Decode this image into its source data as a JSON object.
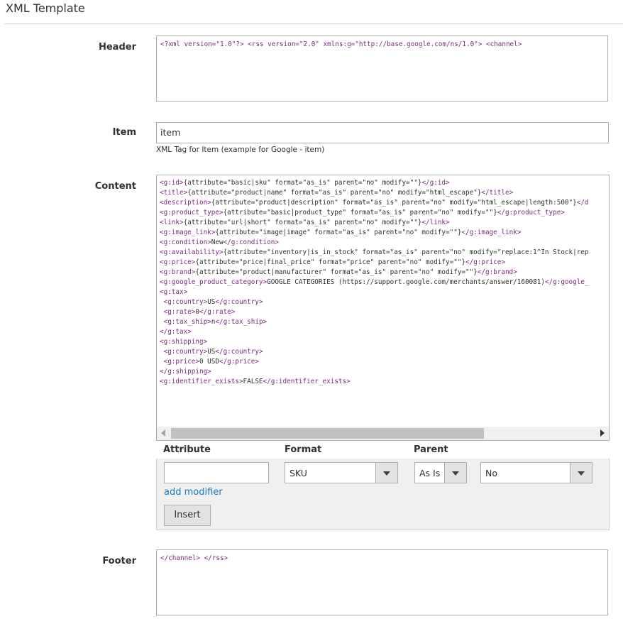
{
  "section": {
    "title": "XML Template"
  },
  "header": {
    "label": "Header",
    "value": "<?xml version=\"1.0\"?> <rss version=\"2.0\" xmlns:g=\"http://base.google.com/ns/1.0\"> <channel>"
  },
  "item": {
    "label": "Item",
    "value": "item",
    "note": "XML Tag for Item (example for Google - item)"
  },
  "content": {
    "label": "Content",
    "lines": [
      "<g:id>{attribute=\"basic|sku\" format=\"as_is\" parent=\"no\" modify=\"\"}</g:id>",
      "<title>{attribute=\"product|name\" format=\"as_is\" parent=\"no\" modify=\"html_escape\"}</title>",
      "<description>{attribute=\"product|description\" format=\"as_is\" parent=\"no\" modify=\"html_escape|length:500\"}</d",
      "<g:product_type>{attribute=\"basic|product_type\" format=\"as_is\" parent=\"no\" modify=\"\"}</g:product_type>",
      "<link>{attribute=\"url|short\" format=\"as_is\" parent=\"no\" modify=\"\"}</link>",
      "<g:image_link>{attribute=\"image|image\" format=\"as_is\" parent=\"no\" modify=\"\"}</g:image_link>",
      "<g:condition>New</g:condition>",
      "<g:availability>{attribute=\"inventory|is_in_stock\" format=\"as_is\" parent=\"no\" modify=\"replace:1^In Stock|rep",
      "<g:price>{attribute=\"price|final_price\" format=\"price\" parent=\"no\" modify=\"\"}</g:price>",
      "<g:brand>{attribute=\"product|manufacturer\" format=\"as_is\" parent=\"no\" modify=\"\"}</g:brand>",
      "<g:google_product_category>GOOGLE CATEGORIES (https://support.google.com/merchants/answer/160081)</g:google_",
      "<g:tax>",
      " <g:country>US</g:country>",
      " <g:rate>0</g:rate>",
      " <g:tax_ship>n</g:tax_ship>",
      "</g:tax>",
      "<g:shipping>",
      " <g:country>US</g:country>",
      " <g:price>0 USD</g:price>",
      "</g:shipping>",
      "<g:identifier_exists>FALSE</g:identifier_exists>"
    ]
  },
  "insert_panel": {
    "attribute_label": "Attribute",
    "format_label": "Format",
    "parent_label": "Parent",
    "attribute_value": "",
    "attribute_select": "SKU",
    "format_select": "As Is",
    "parent_select": "No",
    "add_modifier": "add modifier",
    "insert_button": "Insert"
  },
  "footer": {
    "label": "Footer",
    "value": "</channel> </rss>"
  },
  "colors": {
    "tag": "#7b2a7e",
    "link": "#1979c3"
  },
  "icons": [
    "chevron-down-icon",
    "scroll-left-arrow-icon",
    "scroll-right-arrow-icon"
  ]
}
